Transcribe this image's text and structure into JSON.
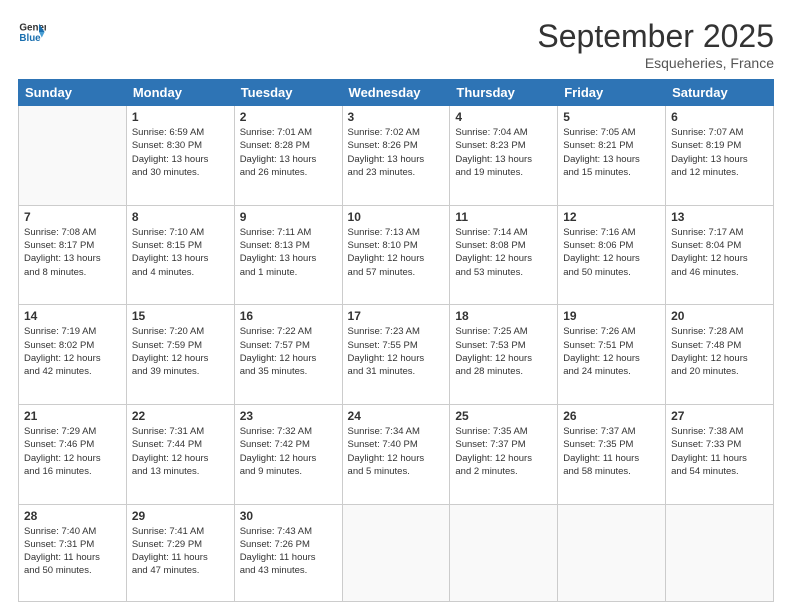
{
  "header": {
    "logo_general": "General",
    "logo_blue": "Blue",
    "month_title": "September 2025",
    "location": "Esqueheries, France"
  },
  "days_of_week": [
    "Sunday",
    "Monday",
    "Tuesday",
    "Wednesday",
    "Thursday",
    "Friday",
    "Saturday"
  ],
  "weeks": [
    [
      {
        "day": "",
        "info": ""
      },
      {
        "day": "1",
        "info": "Sunrise: 6:59 AM\nSunset: 8:30 PM\nDaylight: 13 hours\nand 30 minutes."
      },
      {
        "day": "2",
        "info": "Sunrise: 7:01 AM\nSunset: 8:28 PM\nDaylight: 13 hours\nand 26 minutes."
      },
      {
        "day": "3",
        "info": "Sunrise: 7:02 AM\nSunset: 8:26 PM\nDaylight: 13 hours\nand 23 minutes."
      },
      {
        "day": "4",
        "info": "Sunrise: 7:04 AM\nSunset: 8:23 PM\nDaylight: 13 hours\nand 19 minutes."
      },
      {
        "day": "5",
        "info": "Sunrise: 7:05 AM\nSunset: 8:21 PM\nDaylight: 13 hours\nand 15 minutes."
      },
      {
        "day": "6",
        "info": "Sunrise: 7:07 AM\nSunset: 8:19 PM\nDaylight: 13 hours\nand 12 minutes."
      }
    ],
    [
      {
        "day": "7",
        "info": "Sunrise: 7:08 AM\nSunset: 8:17 PM\nDaylight: 13 hours\nand 8 minutes."
      },
      {
        "day": "8",
        "info": "Sunrise: 7:10 AM\nSunset: 8:15 PM\nDaylight: 13 hours\nand 4 minutes."
      },
      {
        "day": "9",
        "info": "Sunrise: 7:11 AM\nSunset: 8:13 PM\nDaylight: 13 hours\nand 1 minute."
      },
      {
        "day": "10",
        "info": "Sunrise: 7:13 AM\nSunset: 8:10 PM\nDaylight: 12 hours\nand 57 minutes."
      },
      {
        "day": "11",
        "info": "Sunrise: 7:14 AM\nSunset: 8:08 PM\nDaylight: 12 hours\nand 53 minutes."
      },
      {
        "day": "12",
        "info": "Sunrise: 7:16 AM\nSunset: 8:06 PM\nDaylight: 12 hours\nand 50 minutes."
      },
      {
        "day": "13",
        "info": "Sunrise: 7:17 AM\nSunset: 8:04 PM\nDaylight: 12 hours\nand 46 minutes."
      }
    ],
    [
      {
        "day": "14",
        "info": "Sunrise: 7:19 AM\nSunset: 8:02 PM\nDaylight: 12 hours\nand 42 minutes."
      },
      {
        "day": "15",
        "info": "Sunrise: 7:20 AM\nSunset: 7:59 PM\nDaylight: 12 hours\nand 39 minutes."
      },
      {
        "day": "16",
        "info": "Sunrise: 7:22 AM\nSunset: 7:57 PM\nDaylight: 12 hours\nand 35 minutes."
      },
      {
        "day": "17",
        "info": "Sunrise: 7:23 AM\nSunset: 7:55 PM\nDaylight: 12 hours\nand 31 minutes."
      },
      {
        "day": "18",
        "info": "Sunrise: 7:25 AM\nSunset: 7:53 PM\nDaylight: 12 hours\nand 28 minutes."
      },
      {
        "day": "19",
        "info": "Sunrise: 7:26 AM\nSunset: 7:51 PM\nDaylight: 12 hours\nand 24 minutes."
      },
      {
        "day": "20",
        "info": "Sunrise: 7:28 AM\nSunset: 7:48 PM\nDaylight: 12 hours\nand 20 minutes."
      }
    ],
    [
      {
        "day": "21",
        "info": "Sunrise: 7:29 AM\nSunset: 7:46 PM\nDaylight: 12 hours\nand 16 minutes."
      },
      {
        "day": "22",
        "info": "Sunrise: 7:31 AM\nSunset: 7:44 PM\nDaylight: 12 hours\nand 13 minutes."
      },
      {
        "day": "23",
        "info": "Sunrise: 7:32 AM\nSunset: 7:42 PM\nDaylight: 12 hours\nand 9 minutes."
      },
      {
        "day": "24",
        "info": "Sunrise: 7:34 AM\nSunset: 7:40 PM\nDaylight: 12 hours\nand 5 minutes."
      },
      {
        "day": "25",
        "info": "Sunrise: 7:35 AM\nSunset: 7:37 PM\nDaylight: 12 hours\nand 2 minutes."
      },
      {
        "day": "26",
        "info": "Sunrise: 7:37 AM\nSunset: 7:35 PM\nDaylight: 11 hours\nand 58 minutes."
      },
      {
        "day": "27",
        "info": "Sunrise: 7:38 AM\nSunset: 7:33 PM\nDaylight: 11 hours\nand 54 minutes."
      }
    ],
    [
      {
        "day": "28",
        "info": "Sunrise: 7:40 AM\nSunset: 7:31 PM\nDaylight: 11 hours\nand 50 minutes."
      },
      {
        "day": "29",
        "info": "Sunrise: 7:41 AM\nSunset: 7:29 PM\nDaylight: 11 hours\nand 47 minutes."
      },
      {
        "day": "30",
        "info": "Sunrise: 7:43 AM\nSunset: 7:26 PM\nDaylight: 11 hours\nand 43 minutes."
      },
      {
        "day": "",
        "info": ""
      },
      {
        "day": "",
        "info": ""
      },
      {
        "day": "",
        "info": ""
      },
      {
        "day": "",
        "info": ""
      }
    ]
  ]
}
